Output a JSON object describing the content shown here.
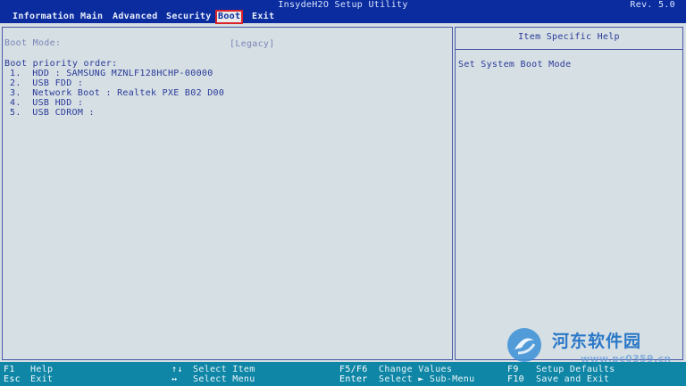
{
  "header": {
    "title": "InsydeH2O Setup Utility",
    "rev": "Rev. 5.0"
  },
  "menu": [
    {
      "label": "Information"
    },
    {
      "label": "Main"
    },
    {
      "label": "Advanced"
    },
    {
      "label": "Security"
    },
    {
      "label": "Boot"
    },
    {
      "label": "Exit"
    }
  ],
  "main": {
    "boot_mode_label": "Boot Mode:",
    "boot_mode_value": "[Legacy]",
    "priority_label": "Boot priority order:",
    "boot_items": [
      "1.  HDD : SAMSUNG MZNLF128HCHP-00000",
      "2.  USB FDD :",
      "3.  Network Boot : Realtek PXE B02 D00",
      "4.  USB HDD :",
      "5.  USB CDROM :"
    ]
  },
  "help": {
    "title": "Item Specific Help",
    "text": "Set System Boot Mode"
  },
  "footer": {
    "keys": [
      {
        "key": "F1",
        "action": "Help"
      },
      {
        "key": "Esc",
        "action": "Exit"
      },
      {
        "key": "↑↓",
        "action": "Select Item"
      },
      {
        "key": "↔",
        "action": "Select Menu"
      },
      {
        "key": "F5/F6",
        "action": "Change Values"
      },
      {
        "key": "Enter",
        "action": "Select ► Sub-Menu"
      },
      {
        "key": "F9",
        "action": "Setup Defaults"
      },
      {
        "key": "F10",
        "action": "Save and Exit"
      }
    ]
  },
  "watermark": {
    "text": "河东软件园",
    "url": "www.pc0359.cn"
  },
  "colors": {
    "title_bg": "#0a2c9e",
    "body_bg": "#d6dfe4",
    "text": "#2a3a98",
    "footer_bg": "#0f86a6",
    "highlight_border": "#d8242a"
  }
}
